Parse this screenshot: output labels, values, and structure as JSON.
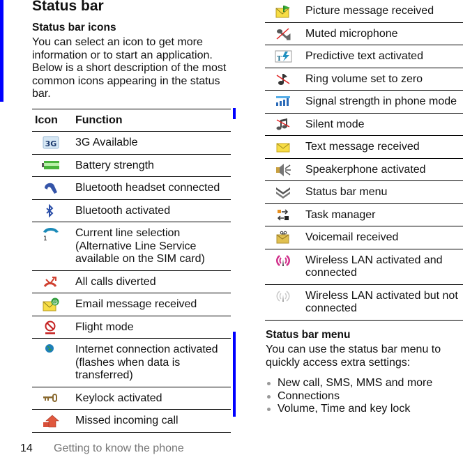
{
  "page": {
    "title": "Status bar",
    "section_icons": {
      "heading": "Status bar icons",
      "intro": "You can select an icon to get more information or to start an application. Below is a short description of the most common icons appearing in the status bar."
    },
    "table_headers": {
      "icon": "Icon",
      "function": "Function"
    },
    "left_rows": [
      {
        "icon": "3g-icon",
        "label": "3G Available"
      },
      {
        "icon": "battery-icon",
        "label": "Battery strength"
      },
      {
        "icon": "bluetooth-headset-icon",
        "label": "Bluetooth headset connected"
      },
      {
        "icon": "bluetooth-icon",
        "label": "Bluetooth activated"
      },
      {
        "icon": "line-selection-icon",
        "label": "Current line selection (Alternative Line Service available on the SIM card)"
      },
      {
        "icon": "call-divert-icon",
        "label": "All calls diverted"
      },
      {
        "icon": "email-icon",
        "label": "Email message received"
      },
      {
        "icon": "flight-mode-icon",
        "label": "Flight mode"
      },
      {
        "icon": "globe-icon",
        "label": "Internet connection activated (flashes when data is transferred)"
      },
      {
        "icon": "key-icon",
        "label": "Keylock activated"
      },
      {
        "icon": "missed-call-icon",
        "label": "Missed incoming call"
      }
    ],
    "right_rows": [
      {
        "icon": "picture-message-icon",
        "label": "Picture message received"
      },
      {
        "icon": "muted-microphone-icon",
        "label": "Muted microphone"
      },
      {
        "icon": "predictive-text-icon",
        "label": "Predictive text activated"
      },
      {
        "icon": "ring-volume-zero-icon",
        "label": "Ring volume set to zero"
      },
      {
        "icon": "signal-strength-icon",
        "label": "Signal strength in phone mode"
      },
      {
        "icon": "silent-mode-icon",
        "label": "Silent mode"
      },
      {
        "icon": "text-message-icon",
        "label": "Text message received"
      },
      {
        "icon": "speakerphone-icon",
        "label": "Speakerphone activated"
      },
      {
        "icon": "status-bar-menu-icon",
        "label": "Status bar menu"
      },
      {
        "icon": "task-manager-icon",
        "label": "Task manager"
      },
      {
        "icon": "voicemail-icon",
        "label": "Voicemail received"
      },
      {
        "icon": "wlan-connected-icon",
        "label": "Wireless LAN activated and connected"
      },
      {
        "icon": "wlan-not-connected-icon",
        "label": "Wireless LAN activated but not connected"
      }
    ],
    "section_menu": {
      "heading": "Status bar menu",
      "intro": "You can use the status bar menu to quickly access extra settings:",
      "bullets": [
        "New call, SMS, MMS and more",
        "Connections",
        "Volume, Time and key lock"
      ]
    },
    "footer": {
      "page_number": "14",
      "chapter": "Getting to know the phone"
    },
    "colors": {
      "change_bar": "#0000ff",
      "footer_text": "#777777"
    }
  }
}
